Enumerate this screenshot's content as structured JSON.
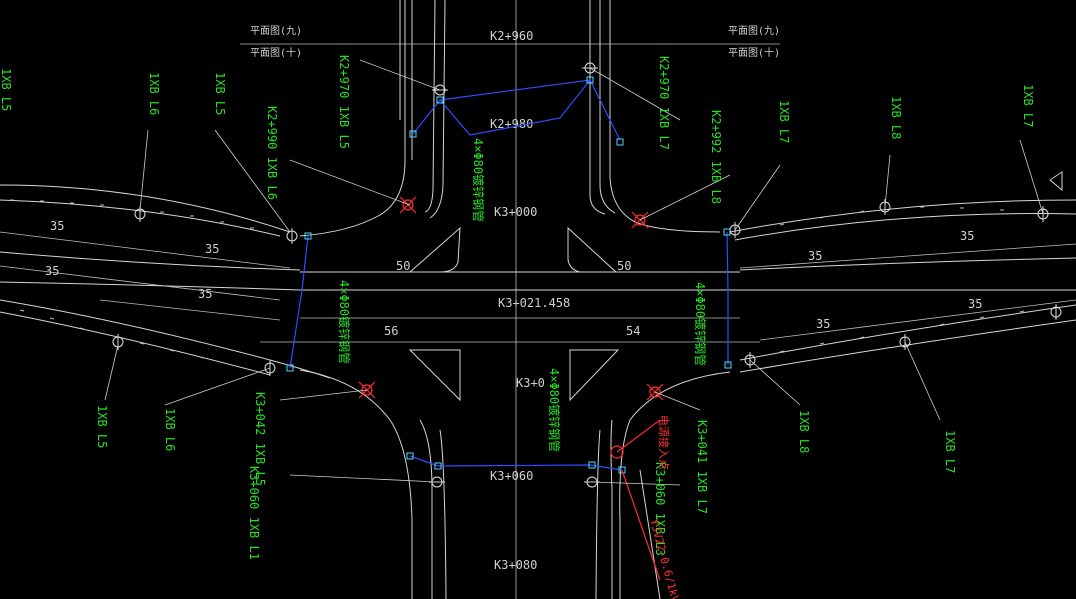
{
  "colors": {
    "background": "#000000",
    "linework": "#d6d6d6",
    "label_green": "#23e023",
    "leader_red": "#ff2a2a",
    "cable_blue": "#2f4cff"
  },
  "sheet_refs": {
    "top_left_1": "平面图(九)",
    "top_left_2": "平面图(十)",
    "top_right_1": "平面图(九)",
    "top_right_2": "平面图(十)"
  },
  "stations": {
    "k2_960": "K2+960",
    "k2_980": "K2+980",
    "k3_000": "K3+000",
    "k3_021": "K3+021.458",
    "k3_040": "K3+0",
    "k3_060": "K3+060",
    "k3_080": "K3+080"
  },
  "dimensions": {
    "d35_a": "35",
    "d35_b": "35",
    "d35_c": "35",
    "d35_d": "35",
    "d35_e": "35",
    "d35_f": "35",
    "d35_g": "35",
    "d35_h": "35",
    "d50_l": "50",
    "d50_r": "50",
    "d56": "56",
    "d54": "54"
  },
  "conduits": {
    "north": "4×Φ80镀锌钢管",
    "west": "4×Φ80镀锌钢管",
    "east": "4×Φ80镀锌钢管",
    "south": "4×Φ80镀锌钢管"
  },
  "pole_labels": {
    "lbl_1": "1XB L5",
    "lbl_2": "1XB L6",
    "lbl_3": "1XB L5",
    "lbl_4": "K2+990 1XB L6",
    "lbl_5": "K2+970 1XB L5",
    "lbl_6": "K2+970 1XB L7",
    "lbl_7": "K2+992 1XB L8",
    "lbl_8": "1XB L7",
    "lbl_9": "1XB L8",
    "lbl_10": "1XB L7",
    "lbl_11": "1XB L5",
    "lbl_12": "1XB L6",
    "lbl_13": "K3+042 1XB L5",
    "lbl_14": "K3+060 1XB L1",
    "lbl_15": "K3+041 1XB L7",
    "lbl_16": "1XB L8",
    "lbl_17": "1XB L7",
    "lbl_18": "K3+060 1XB L3"
  },
  "red_notes": {
    "power_entry": "电源接入点",
    "cable_spec": "YJV22-0.6/1kV"
  }
}
